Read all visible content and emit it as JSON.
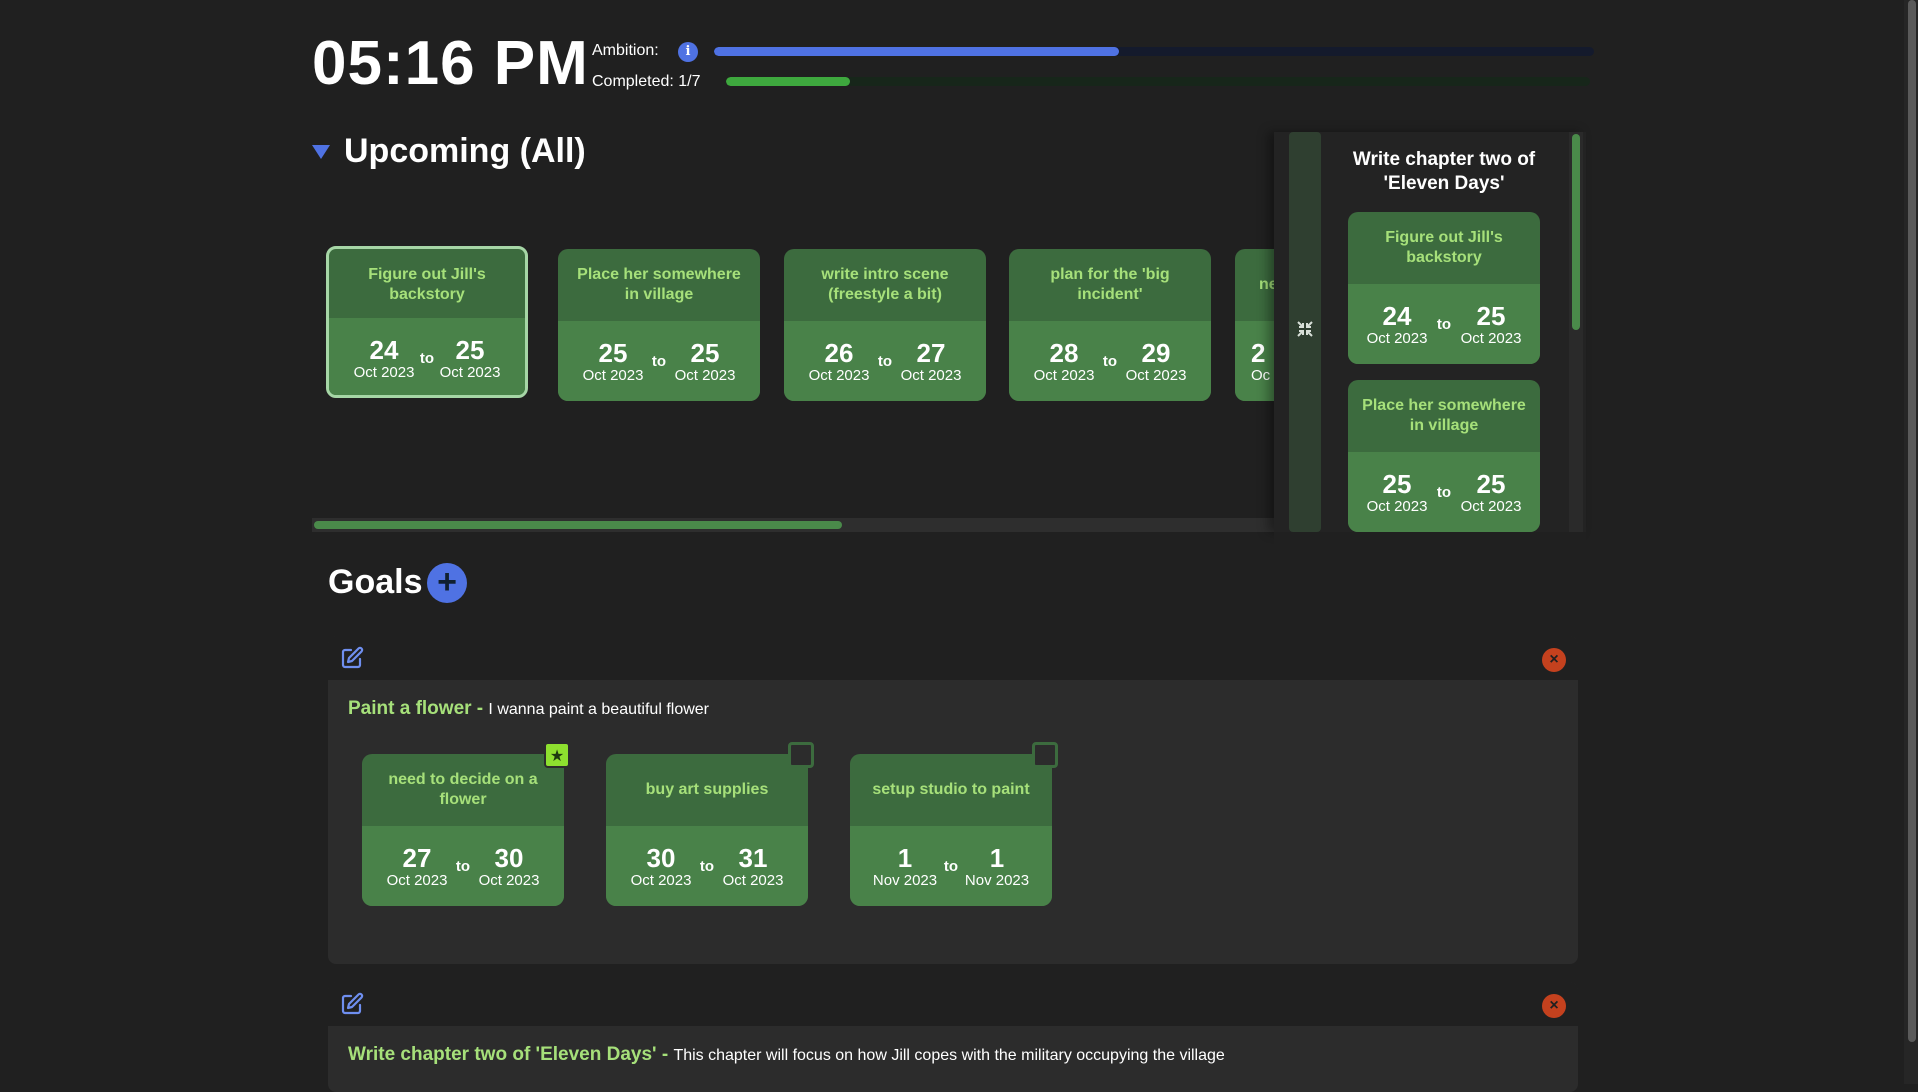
{
  "header": {
    "time": "05:16 PM",
    "ambition_label": "Ambition:",
    "ambition_level": 0.46,
    "completed_label": "Completed: 1/7",
    "completed_level": 0.143,
    "colors": {
      "ambition": "#4f72e3",
      "completed": "#3ea83e"
    }
  },
  "upcoming": {
    "title": "Upcoming (All)",
    "cards": [
      {
        "title": "Figure out Jill's backstory",
        "from_day": "24",
        "from_my": "Oct 2023",
        "to_day": "25",
        "to_my": "Oct 2023"
      },
      {
        "title": "Place her somewhere in village",
        "from_day": "25",
        "from_my": "Oct 2023",
        "to_day": "25",
        "to_my": "Oct 2023"
      },
      {
        "title": "write intro scene (freestyle a bit)",
        "from_day": "26",
        "from_my": "Oct 2023",
        "to_day": "27",
        "to_my": "Oct 2023"
      },
      {
        "title": "plan for the 'big incident'",
        "from_day": "28",
        "from_my": "Oct 2023",
        "to_day": "29",
        "to_my": "Oct 2023"
      },
      {
        "title": "ne",
        "from_day": "2",
        "from_my": "Oc",
        "to_day": "",
        "to_my": ""
      }
    ],
    "to_word": "to"
  },
  "side_panel": {
    "title": "Write chapter two of 'Eleven Days'",
    "cards": [
      {
        "title": "Figure out Jill's backstory",
        "from_day": "24",
        "from_my": "Oct 2023",
        "to_day": "25",
        "to_my": "Oct 2023"
      },
      {
        "title": "Place her somewhere in village",
        "from_day": "25",
        "from_my": "Oct 2023",
        "to_day": "25",
        "to_my": "Oct 2023"
      }
    ]
  },
  "goals": {
    "title": "Goals",
    "add_label": "+",
    "items": [
      {
        "name": "Paint a flower",
        "separator": " - ",
        "description": "I wanna paint a beautiful flower",
        "tasks": [
          {
            "title": "need to decide on a flower",
            "from_day": "27",
            "from_my": "Oct 2023",
            "to_day": "30",
            "to_my": "Oct 2023",
            "starred": "★"
          },
          {
            "title": "buy art supplies",
            "from_day": "30",
            "from_my": "Oct 2023",
            "to_day": "31",
            "to_my": "Oct 2023"
          },
          {
            "title": "setup studio to paint",
            "from_day": "1",
            "from_my": "Nov 2023",
            "to_day": "1",
            "to_my": "Nov 2023"
          }
        ]
      },
      {
        "name": "Write chapter two of 'Eleven Days'",
        "separator": " - ",
        "description": "This chapter will focus on how Jill copes with the military occupying the village"
      }
    ]
  }
}
